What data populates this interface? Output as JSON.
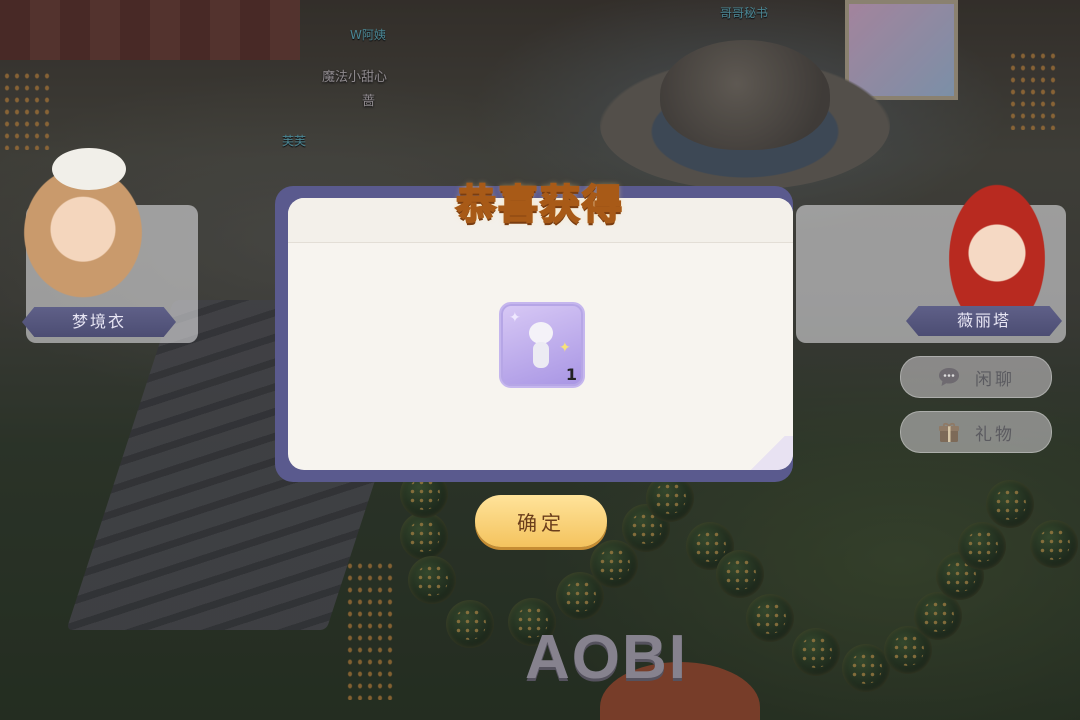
{
  "dialog": {
    "title": "恭喜获得",
    "item": {
      "icon": "white-bear-costume-icon",
      "count": "1"
    },
    "confirm_label": "确定"
  },
  "characters": {
    "left": {
      "name": "梦境衣"
    },
    "right": {
      "name": "薇丽塔"
    }
  },
  "actions": {
    "chat": {
      "label": "闲聊",
      "icon": "chat-bubble-icon"
    },
    "gift": {
      "label": "礼物",
      "icon": "gift-box-icon"
    }
  },
  "world_labels": {
    "npc1": "W阿姨",
    "npc2": "魔法小甜心",
    "npc3": "蔷",
    "npc4": "芙芙",
    "npc5": "哥哥秘书"
  },
  "signage": {
    "stage_text": "AOBI"
  },
  "colors": {
    "title_gold": "#ffcf4f",
    "dialog_bg": "#f7f4ef",
    "dialog_border": "#5a5a8e",
    "confirm_button": "#f4c35e",
    "item_slot_purple": "#a895e4"
  }
}
